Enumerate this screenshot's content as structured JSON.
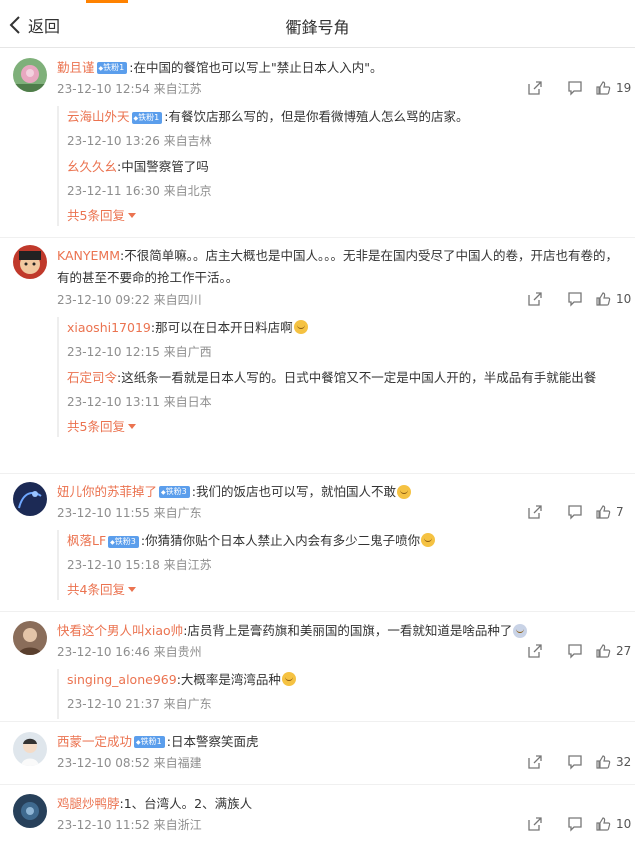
{
  "header": {
    "back_label": "返回",
    "title": "衢鋒号角"
  },
  "comments": [
    {
      "user": "勤且谨",
      "badge": "铁粉1",
      "text": ":在中国的餐馆也可以写上\"禁止日本人入内\"。",
      "time": "23-12-10 12:54 来自江苏",
      "likes": "19",
      "replies": [
        {
          "user": "云海山外天",
          "badge": "铁粉1",
          "text": ":有餐饮店那么写的，但是你看微博殖人怎么骂的店家。",
          "time": "23-12-10 13:26 来自吉林"
        },
        {
          "user": "幺久久幺",
          "badge": "",
          "text": ":中国警察管了吗",
          "time": "23-12-11 16:30 来自北京"
        }
      ],
      "more": "共5条回复"
    },
    {
      "user": "KANYEMM",
      "badge": "",
      "text": ":不很简单嘛。。店主大概也是中国人。。。无非是在国内受尽了中国人的卷，开店也有卷的，有的甚至不要命的抢工作干活。。",
      "time": "23-12-10 09:22 来自四川",
      "likes": "10",
      "replies": [
        {
          "user": "xiaoshi17019",
          "badge": "",
          "text": ":那可以在日本开日料店啊",
          "time": "23-12-10 12:15 来自广西"
        },
        {
          "user": "石定司令",
          "badge": "",
          "text": ":这纸条一看就是日本人写的。日式中餐馆又不一定是中国人开的，半成品有手就能出餐",
          "time": "23-12-10 13:11 来自日本"
        }
      ],
      "more": "共5条回复"
    },
    {
      "user": "妞儿你的苏菲掉了",
      "badge": "铁粉3",
      "text": ":我们的饭店也可以写，就怕国人不敢",
      "time": "23-12-10 11:55 来自广东",
      "likes": "7",
      "replies": [
        {
          "user": "枫落LF",
          "badge": "铁粉3",
          "text": ":你猜猜你贴个日本人禁止入内会有多少二鬼子喷你",
          "time": "23-12-10 15:18 来自江苏"
        }
      ],
      "more": "共4条回复"
    },
    {
      "user": "快看这个男人叫xiao帅",
      "badge": "",
      "text": ":店员背上是膏药旗和美丽国的国旗，一看就知道是啥品种了",
      "time": "23-12-10 16:46 来自贵州",
      "likes": "27",
      "replies": [
        {
          "user": "singing_alone969",
          "badge": "",
          "text": ":大概率是湾湾品种",
          "time": "23-12-10 21:37 来自广东"
        }
      ],
      "more": ""
    },
    {
      "user": "西蒙一定成功",
      "badge": "铁粉1",
      "text": ":日本警察笑面虎",
      "time": "23-12-10 08:52 来自福建",
      "likes": "32",
      "replies": [],
      "more": ""
    },
    {
      "user": "鸡腿炒鸭脖",
      "badge": "",
      "text": ":1、台湾人。2、满族人",
      "time": "23-12-10 11:52 来自浙江",
      "likes": "10",
      "replies": [],
      "more": ""
    }
  ],
  "colors": {
    "username": "#eb7350",
    "badge": "#5b9eec",
    "meta": "#8e8e8e",
    "accent": "#ff8200"
  }
}
